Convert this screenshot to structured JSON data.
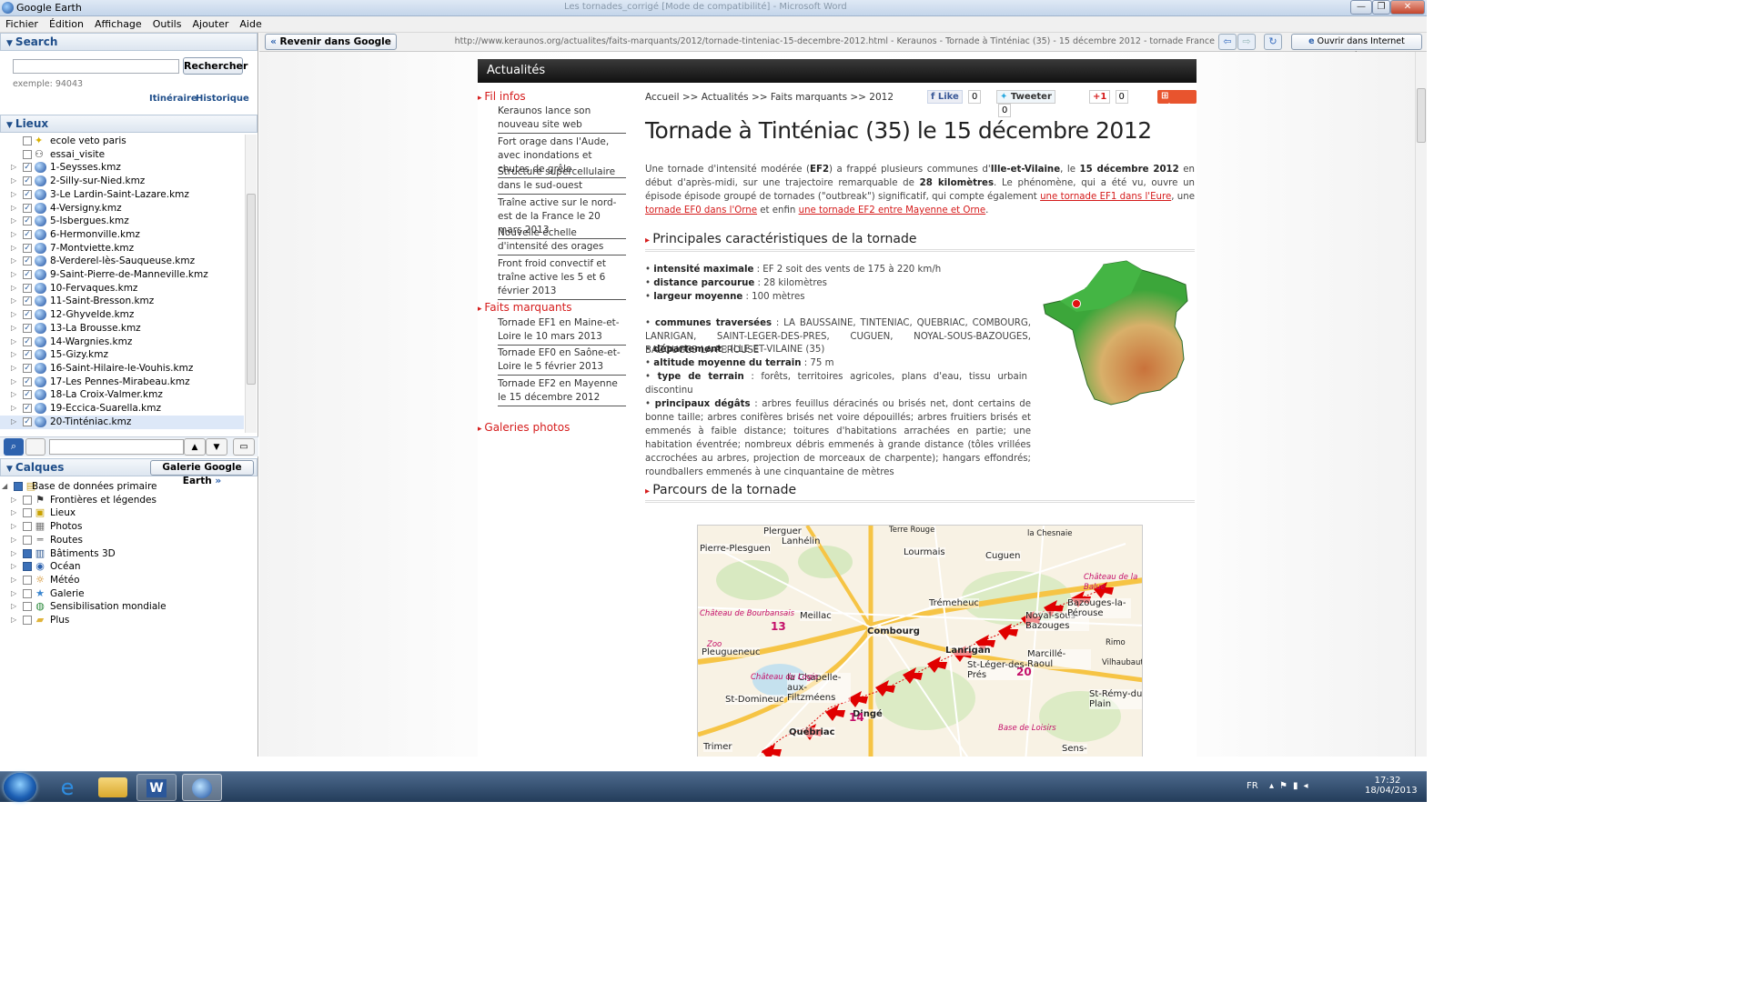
{
  "titlebar": {
    "app_title": "Google Earth",
    "window_title": "Les tornades_corrigé [Mode de compatibilité] - Microsoft Word"
  },
  "menu": [
    "Fichier",
    "Édition",
    "Affichage",
    "Outils",
    "Ajouter",
    "Aide"
  ],
  "search": {
    "header": "Search",
    "button": "Rechercher",
    "hint": "exemple: 94043",
    "link_itinerary": "Itinéraire",
    "link_history": "Historique",
    "value": ""
  },
  "places": {
    "header": "Lieux",
    "items": [
      {
        "label": "ecole veto paris",
        "checked": false,
        "icon": "pushpin-icon"
      },
      {
        "label": "essai_visite",
        "checked": false,
        "icon": "tour-icon"
      },
      {
        "label": "1-Seysses.kmz",
        "checked": true,
        "icon": "kmz-icon"
      },
      {
        "label": "2-Silly-sur-Nied.kmz",
        "checked": true,
        "icon": "kmz-icon"
      },
      {
        "label": "3-Le Lardin-Saint-Lazare.kmz",
        "checked": true,
        "icon": "kmz-icon"
      },
      {
        "label": "4-Versigny.kmz",
        "checked": true,
        "icon": "kmz-icon"
      },
      {
        "label": "5-Isbergues.kmz",
        "checked": true,
        "icon": "kmz-icon"
      },
      {
        "label": "6-Hermonville.kmz",
        "checked": true,
        "icon": "kmz-icon"
      },
      {
        "label": "7-Montviette.kmz",
        "checked": true,
        "icon": "kmz-icon"
      },
      {
        "label": "8-Verderel-lès-Sauqueuse.kmz",
        "checked": true,
        "icon": "kmz-icon"
      },
      {
        "label": "9-Saint-Pierre-de-Manneville.kmz",
        "checked": true,
        "icon": "kmz-icon"
      },
      {
        "label": "10-Fervaques.kmz",
        "checked": true,
        "icon": "kmz-icon"
      },
      {
        "label": "11-Saint-Bresson.kmz",
        "checked": true,
        "icon": "kmz-icon"
      },
      {
        "label": "12-Ghyvelde.kmz",
        "checked": true,
        "icon": "kmz-icon"
      },
      {
        "label": "13-La Brousse.kmz",
        "checked": true,
        "icon": "kmz-icon"
      },
      {
        "label": "14-Wargnies.kmz",
        "checked": true,
        "icon": "kmz-icon"
      },
      {
        "label": "15-Gizy.kmz",
        "checked": true,
        "icon": "kmz-icon"
      },
      {
        "label": "16-Saint-Hilaire-le-Vouhis.kmz",
        "checked": true,
        "icon": "kmz-icon"
      },
      {
        "label": "17-Les Pennes-Mirabeau.kmz",
        "checked": true,
        "icon": "kmz-icon"
      },
      {
        "label": "18-La Croix-Valmer.kmz",
        "checked": true,
        "icon": "kmz-icon"
      },
      {
        "label": "19-Eccica-Suarella.kmz",
        "checked": true,
        "icon": "kmz-icon"
      },
      {
        "label": "20-Tinténiac.kmz",
        "checked": true,
        "icon": "kmz-icon",
        "selected": true
      }
    ]
  },
  "layers": {
    "header": "Calques",
    "gallery_button": "Galerie Google Earth",
    "items": [
      {
        "label": "Base de données primaire",
        "checked": true,
        "icon": "database-icon",
        "indent": 0
      },
      {
        "label": "Frontières et légendes",
        "checked": false,
        "icon": "flag-icon"
      },
      {
        "label": "Lieux",
        "checked": false,
        "icon": "place-icon"
      },
      {
        "label": "Photos",
        "checked": false,
        "icon": "photo-icon"
      },
      {
        "label": "Routes",
        "checked": false,
        "icon": "road-icon"
      },
      {
        "label": "Bâtiments 3D",
        "checked": true,
        "icon": "building-icon"
      },
      {
        "label": "Océan",
        "checked": true,
        "icon": "ocean-icon"
      },
      {
        "label": "Météo",
        "checked": false,
        "icon": "weather-icon"
      },
      {
        "label": "Galerie",
        "checked": false,
        "icon": "gallery-icon"
      },
      {
        "label": "Sensibilisation mondiale",
        "checked": false,
        "icon": "globe-icon"
      },
      {
        "label": "Plus",
        "checked": false,
        "icon": "folder-icon"
      }
    ]
  },
  "browserbar": {
    "back_button": "Revenir dans Google Earth",
    "url": "http://www.keraunos.org/actualites/faits-marquants/2012/tornade-tinteniac-15-decembre-2012.html - Keraunos - Tornade à Tinténiac (35) - 15 décembre 2012 - tornade France",
    "ie_button": "Ouvrir dans Internet Explorer"
  },
  "page": {
    "section_bar": "Actualités",
    "fil_infos": {
      "title": "Fil infos",
      "items": [
        "Keraunos lance son nouveau site web",
        "Fort orage dans l'Aude, avec inondations et chutes de grêle",
        "Structure supercellulaire dans le sud-ouest",
        "Traîne active sur le nord-est de la France le 20 mars 2013",
        "Nouvelle échelle d'intensité des orages",
        "Front froid convectif et traîne active les 5 et 6 février 2013"
      ]
    },
    "faits": {
      "title": "Faits marquants",
      "items": [
        "Tornade EF1 en Maine-et-Loire le 10 mars 2013",
        "Tornade EF0 en Saône-et-Loire le 5 février 2013",
        "Tornade EF2 en Mayenne le 15 décembre 2012"
      ]
    },
    "galeries": "Galeries photos",
    "breadcrumb": "Accueil >> Actualités >> Faits marquants >> 2012",
    "social": {
      "like": "Like",
      "like_count": "0",
      "tweet": "Tweeter",
      "tweet_count": "0",
      "plus": "+1",
      "plus_count": "0",
      "share": "Share"
    },
    "title": "Tornade à Tinténiac (35) le 15 décembre 2012",
    "intro": {
      "t1": "Une tornade d'intensité modérée (",
      "ef": "EF2",
      "t2": ") a frappé plusieurs communes d'",
      "dept": "Ille-et-Vilaine",
      "t3": ", le ",
      "date": "15 décembre 2012",
      "t4": " en début d'après-midi, sur une trajectoire remarquable de ",
      "dist": "28 kilomètres",
      "t5": ". Le phénomène, qui a été vu, ouvre un épisode épisode groupé de tornades (\"outbreak\") significatif, qui compte également ",
      "l1": "une tornade EF1 dans l'Eure",
      "t6": ", une",
      "l2": " tornade EF0 dans l'Orne",
      "t7": " et enfin ",
      "l3": "une tornade EF2 entre Mayenne et Orne",
      "t8": "."
    },
    "h2_char": "Principales caractéristiques de la tornade",
    "carac": [
      {
        "k": "intensité maximale",
        "v": " : EF 2 soit des vents de 175 à 220 km/h"
      },
      {
        "k": "distance parcourue",
        "v": " : 28 kilomètres"
      },
      {
        "k": "largeur moyenne",
        "v": " : 100 mètres"
      }
    ],
    "communes": {
      "k": "communes traversées",
      "v": " : LA BAUSSAINE, TINTENIAC, QUEBRIAC, COMBOURG, LANRIGAN, SAINT-LEGER-DES-PRES, CUGUEN, NOYAL-SOUS-BAZOUGES, BAZOUGES-LA-PEROUSE"
    },
    "carac2": [
      {
        "k": "département",
        "v": " : ILLE-ET-VILAINE (35)"
      },
      {
        "k": "altitude moyenne du terrain",
        "v": " : 75 m"
      },
      {
        "k": "type de terrain",
        "v": " : forêts, territoires agricoles, plans d'eau, tissu urbain discontinu"
      }
    ],
    "degats": {
      "k": "principaux dégâts",
      "v": " : arbres feuillus déracinés ou brisés net, dont certains de bonne taille; arbres conifères brisés net voire dépouillés; arbres fruitiers brisés et emmenés à faible distance; toitures d'habitations arrachées en partie; une habitation éventrée; nombreux débris emmenés à grande distance (tôles vrillées accrochées au arbres, projection de morceaux de charpente); hangars effondrés; roundballers emmenés à une cinquantaine de mètres"
    },
    "h2_parcours": "Parcours de la tornade",
    "map_labels": [
      "Plerguer",
      "Pierre-Plesguen",
      "Lanhélin",
      "Lourmais",
      "Cuguen",
      "Trémeheuc",
      "Meillac",
      "Combourg",
      "Lanrigan",
      "Noyal-sous-Bazouges",
      "Bazouges-la-Pérouse",
      "Pleugueneuc",
      "St-Léger-des-Prés",
      "Marcillé-Raoul",
      "St-Domineuc",
      "la Chapelle-aux-Filtzméens",
      "Dingé",
      "Québriac",
      "St-Rémy-du-Plain",
      "Trimer",
      "Sens-",
      "Château de Bourbansais",
      "Château du Logis",
      "Château de la Balue",
      "Zoo",
      "Base de Loisirs",
      "13",
      "14",
      "20",
      "Rimo",
      "Vilhaubaut",
      "Terre Rouge",
      "la Chesnaie"
    ]
  },
  "taskbar": {
    "lang": "FR",
    "time": "17:32",
    "date": "18/04/2013"
  }
}
